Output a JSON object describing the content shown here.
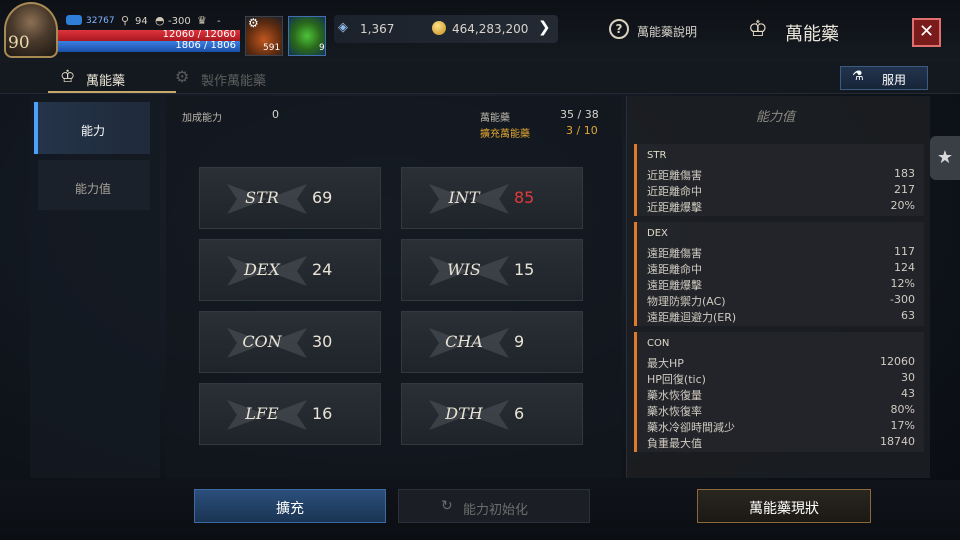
{
  "player": {
    "level": "90",
    "exp": "32767",
    "keys": "94",
    "helm": "-300",
    "trophy": "-",
    "hp": "12060 / 12060",
    "mp": "1806 / 1806"
  },
  "items": {
    "slot1_count": "591",
    "slot2_count": "9"
  },
  "resources": {
    "crystal": "1,367",
    "gold": "464,283,200"
  },
  "header": {
    "help_label": "萬能藥說明",
    "title": "萬能藥"
  },
  "tabs": [
    {
      "label": "萬能藥"
    },
    {
      "label": "製作萬能藥"
    }
  ],
  "use_button": "服用",
  "nav": [
    {
      "label": "能力"
    },
    {
      "label": "能力值"
    }
  ],
  "summary": {
    "bonus_label": "加成能力",
    "bonus_value": "0",
    "potion_label": "萬能藥",
    "potion_value": "35 / 38",
    "expand_label": "擴充萬能藥",
    "expand_value": "3 / 10"
  },
  "stats": [
    {
      "name": "STR",
      "value": "69",
      "highlight": false
    },
    {
      "name": "INT",
      "value": "85",
      "highlight": true
    },
    {
      "name": "DEX",
      "value": "24",
      "highlight": false
    },
    {
      "name": "WIS",
      "value": "15",
      "highlight": false
    },
    {
      "name": "CON",
      "value": "30",
      "highlight": false
    },
    {
      "name": "CHA",
      "value": "9",
      "highlight": false
    },
    {
      "name": "LFE",
      "value": "16",
      "highlight": false
    },
    {
      "name": "DTH",
      "value": "6",
      "highlight": false
    }
  ],
  "attributes": {
    "title": "能力值",
    "groups": [
      {
        "name": "STR",
        "rows": [
          {
            "label": "近距離傷害",
            "value": "183"
          },
          {
            "label": "近距離命中",
            "value": "217"
          },
          {
            "label": "近距離爆擊",
            "value": "20%"
          }
        ]
      },
      {
        "name": "DEX",
        "rows": [
          {
            "label": "遠距離傷害",
            "value": "117"
          },
          {
            "label": "遠距離命中",
            "value": "124"
          },
          {
            "label": "遠距離爆擊",
            "value": "12%"
          },
          {
            "label": "物理防禦力(AC)",
            "value": "-300"
          },
          {
            "label": "遠距離迴避力(ER)",
            "value": "63"
          }
        ]
      },
      {
        "name": "CON",
        "rows": [
          {
            "label": "最大HP",
            "value": "12060"
          },
          {
            "label": "HP回復(tic)",
            "value": "30"
          },
          {
            "label": "藥水恢復量",
            "value": "43"
          },
          {
            "label": "藥水恢復率",
            "value": "80%"
          },
          {
            "label": "藥水冷卻時間減少",
            "value": "17%"
          },
          {
            "label": "負重最大值",
            "value": "18740"
          }
        ]
      }
    ]
  },
  "buttons": {
    "expand": "擴充",
    "reset": "能力初始化",
    "status": "萬能藥現狀"
  },
  "colors": {
    "accent_blue": "#4ea0ff",
    "highlight_red": "#e03a3a",
    "gold_text": "#e2a632",
    "group_bar": "#e07a2a"
  }
}
